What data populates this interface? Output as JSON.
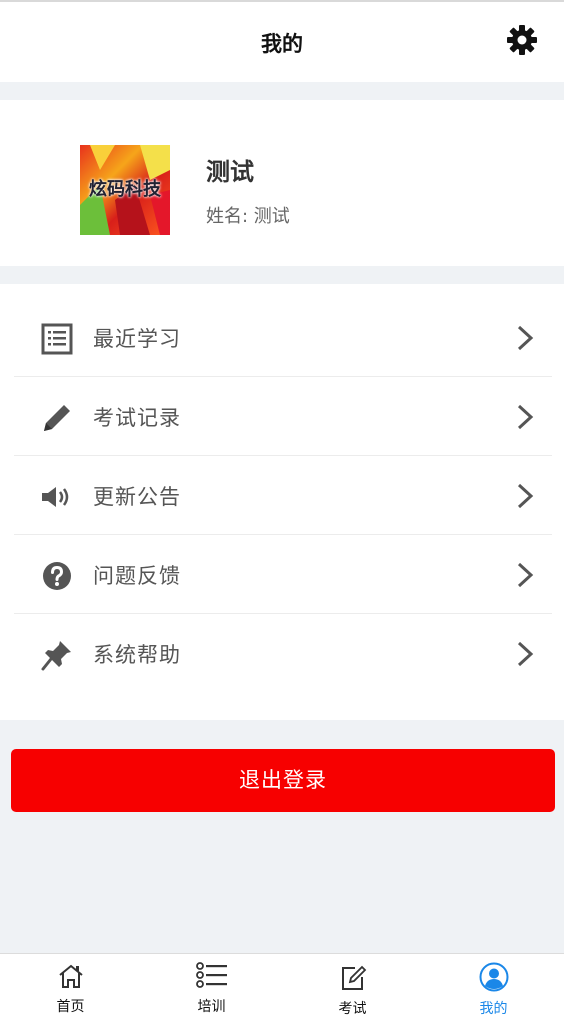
{
  "header": {
    "title": "我的"
  },
  "profile": {
    "avatar_text": "炫码科技",
    "name": "测试",
    "subtitle": "姓名: 测试"
  },
  "menu": {
    "items": [
      {
        "label": "最近学习",
        "icon": "list-icon"
      },
      {
        "label": "考试记录",
        "icon": "pencil-icon"
      },
      {
        "label": "更新公告",
        "icon": "speaker-icon"
      },
      {
        "label": "问题反馈",
        "icon": "question-icon"
      },
      {
        "label": "系统帮助",
        "icon": "pin-icon"
      }
    ]
  },
  "logout_label": "退出登录",
  "tabbar": {
    "tabs": [
      {
        "label": "首页",
        "icon": "home-icon"
      },
      {
        "label": "培训",
        "icon": "list-bullets-icon"
      },
      {
        "label": "考试",
        "icon": "edit-icon"
      },
      {
        "label": "我的",
        "icon": "user-icon"
      }
    ],
    "active_index": 3
  },
  "colors": {
    "accent_red": "#f70000",
    "active_tab": "#1a87e8",
    "background": "#eff2f5"
  }
}
